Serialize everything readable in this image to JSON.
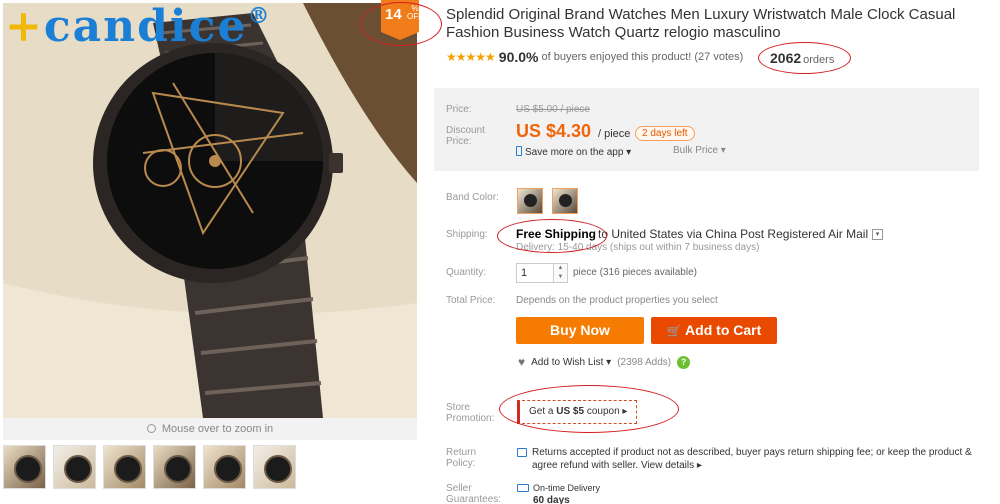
{
  "brand": {
    "logo_plus": "+",
    "logo_text": "candice",
    "logo_reg": "®"
  },
  "discount": {
    "value": "14",
    "percent_sign": "%",
    "off_label": "OFF"
  },
  "gallery": {
    "zoom_hint": "Mouse over to zoom in",
    "thumbnail_count": 6
  },
  "product": {
    "title": "Splendid Original Brand Watches Men Luxury Wristwatch Male Clock Casual Fashion Business Watch Quartz relogio masculino",
    "stars": "★★★★★",
    "rating_percent": "90.0%",
    "rating_text": "of buyers enjoyed this product! (27 votes)",
    "orders_count": "2062",
    "orders_label": "orders"
  },
  "pricing": {
    "price_label": "Price:",
    "old_price": "US $5.00 / piece",
    "discount_label_1": "Discount",
    "discount_label_2": "Price:",
    "new_price": "US $4.30",
    "per_piece": "/ piece",
    "days_left": "2 days left",
    "app_save": "Save more on the app ▾",
    "bulk_price": "Bulk Price ▾"
  },
  "options": {
    "band_color_label": "Band Color:",
    "shipping_label": "Shipping:",
    "free_shipping": "Free Shipping",
    "shipping_rest": "to  United States via China Post Registered Air Mail",
    "shipping_caret": "▾",
    "delivery_note": "Delivery: 15-40 days (ships out within 7 business days)",
    "quantity_label": "Quantity:",
    "quantity_value": "1",
    "quantity_spin": "▲ ▼",
    "quantity_note": "piece (316 pieces available)",
    "total_label": "Total Price:",
    "total_note": "Depends on the product properties you select"
  },
  "actions": {
    "buy_now": "Buy Now",
    "add_to_cart": "Add to Cart",
    "cart_icon": "🛒",
    "wish_icon": "♥",
    "wish_label": "Add to Wish List ▾",
    "wish_adds": "(2398 Adds)",
    "help_icon": "?"
  },
  "store": {
    "label_1": "Store",
    "label_2": "Promotion:",
    "coupon_pre": "Get a ",
    "coupon_bold": "US $5",
    "coupon_post": " coupon ▸"
  },
  "guarantees": {
    "return_label_1": "Return",
    "return_label_2": "Policy:",
    "return_text": "Returns accepted if product not as described, buyer pays return shipping fee; or keep the product & agree refund with seller. View details ▸",
    "seller_label_1": "Seller",
    "seller_label_2": "Guarantees:",
    "ontime": "On-time Delivery",
    "days": "60 days"
  },
  "colors": {
    "accent_orange": "#f57c00",
    "price_orange": "#f0640a",
    "cart_red": "#ea4a00",
    "annotation_red": "#d31f1f",
    "logo_blue": "#1c7fd6"
  }
}
